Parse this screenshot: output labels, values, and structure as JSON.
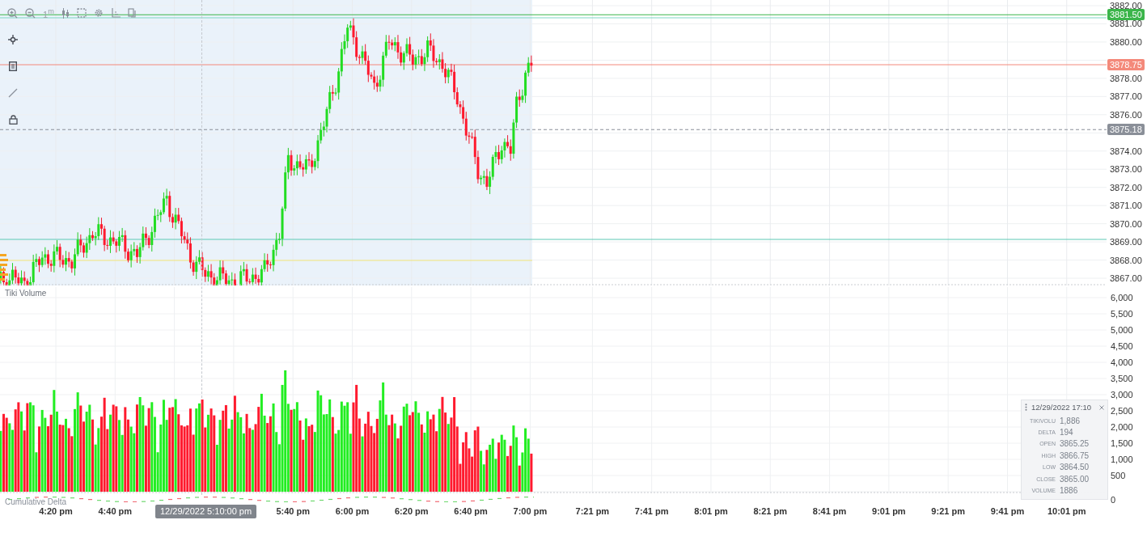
{
  "toolbar": {
    "interval": "1$^{m}$"
  },
  "price_axis": {
    "ticks": [
      "3882.00",
      "3881.00",
      "3880.00",
      "3878.00",
      "3877.00",
      "3876.00",
      "3874.00",
      "3873.00",
      "3872.00",
      "3871.00",
      "3870.00",
      "3869.00",
      "3868.00",
      "3867.00"
    ]
  },
  "price_markers": [
    {
      "label": "3881.50",
      "color": "#3bb54a",
      "kind": "solid"
    },
    {
      "label": "3878.75",
      "color": "#f4897a",
      "kind": "solid"
    },
    {
      "label": "3875.18",
      "color": "#8a8f98",
      "kind": "dashed"
    }
  ],
  "volume_pane": {
    "title": "Tiki Volume",
    "ticks": [
      "6,000",
      "5,500",
      "5,000",
      "4,500",
      "4,000",
      "3,500",
      "3,000",
      "2,500",
      "2,000",
      "1,500",
      "1,000",
      "500",
      "0"
    ]
  },
  "delta_pane": {
    "title": "Cumulative Delta"
  },
  "time_axis": {
    "ticks": [
      "4:20 pm",
      "4:40 pm",
      "5:40 pm",
      "6:00 pm",
      "6:20 pm",
      "6:40 pm",
      "7:00 pm",
      "7:21 pm",
      "7:41 pm",
      "8:01 pm",
      "8:21 pm",
      "8:41 pm",
      "9:01 pm",
      "9:21 pm",
      "9:41 pm",
      "10:01 pm"
    ],
    "crosshair_label": "12/29/2022 5:10:00 pm"
  },
  "tooltip": {
    "title": "12/29/2022 17:10",
    "rows": [
      {
        "label": "TIKIVOLU",
        "value": "1,886"
      },
      {
        "label": "DELTA",
        "value": "194"
      },
      {
        "label": "OPEN",
        "value": "3865.25"
      },
      {
        "label": "HIGH",
        "value": "3866.75"
      },
      {
        "label": "LOW",
        "value": "3864.50"
      },
      {
        "label": "CLOSE",
        "value": "3865.00"
      },
      {
        "label": "VOLUME",
        "value": "1886"
      }
    ]
  }
}
